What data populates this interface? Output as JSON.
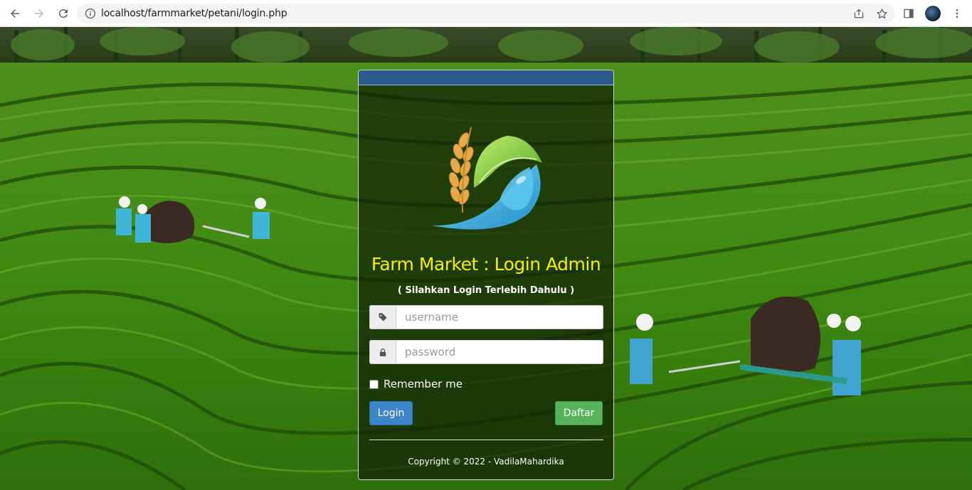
{
  "browser": {
    "url": "localhost/farmmarket/petani/login.php"
  },
  "icons": {
    "back": "arrow-left-icon",
    "forward": "arrow-right-icon",
    "reload": "reload-icon",
    "info": "info-icon",
    "share": "share-icon",
    "bookmark": "star-icon",
    "side_panel": "side-panel-icon",
    "profile": "avatar",
    "menu": "kebab-menu-icon",
    "username_addon": "tag-icon",
    "password_addon": "lock-icon"
  },
  "login": {
    "title": "Farm Market : Login Admin",
    "subtitle": "( Silahkan Login Terlebih Dahulu )",
    "username_placeholder": "username",
    "password_placeholder": "password",
    "remember_label": "Remember me",
    "login_button": "Login",
    "register_button": "Daftar",
    "copyright": "Copyright © 2022 - VadilaMahardika"
  },
  "colors": {
    "header_bar": "#2c5a8c",
    "title": "#f4f000",
    "login_button": "#3d85c8",
    "register_button": "#55b35a"
  }
}
